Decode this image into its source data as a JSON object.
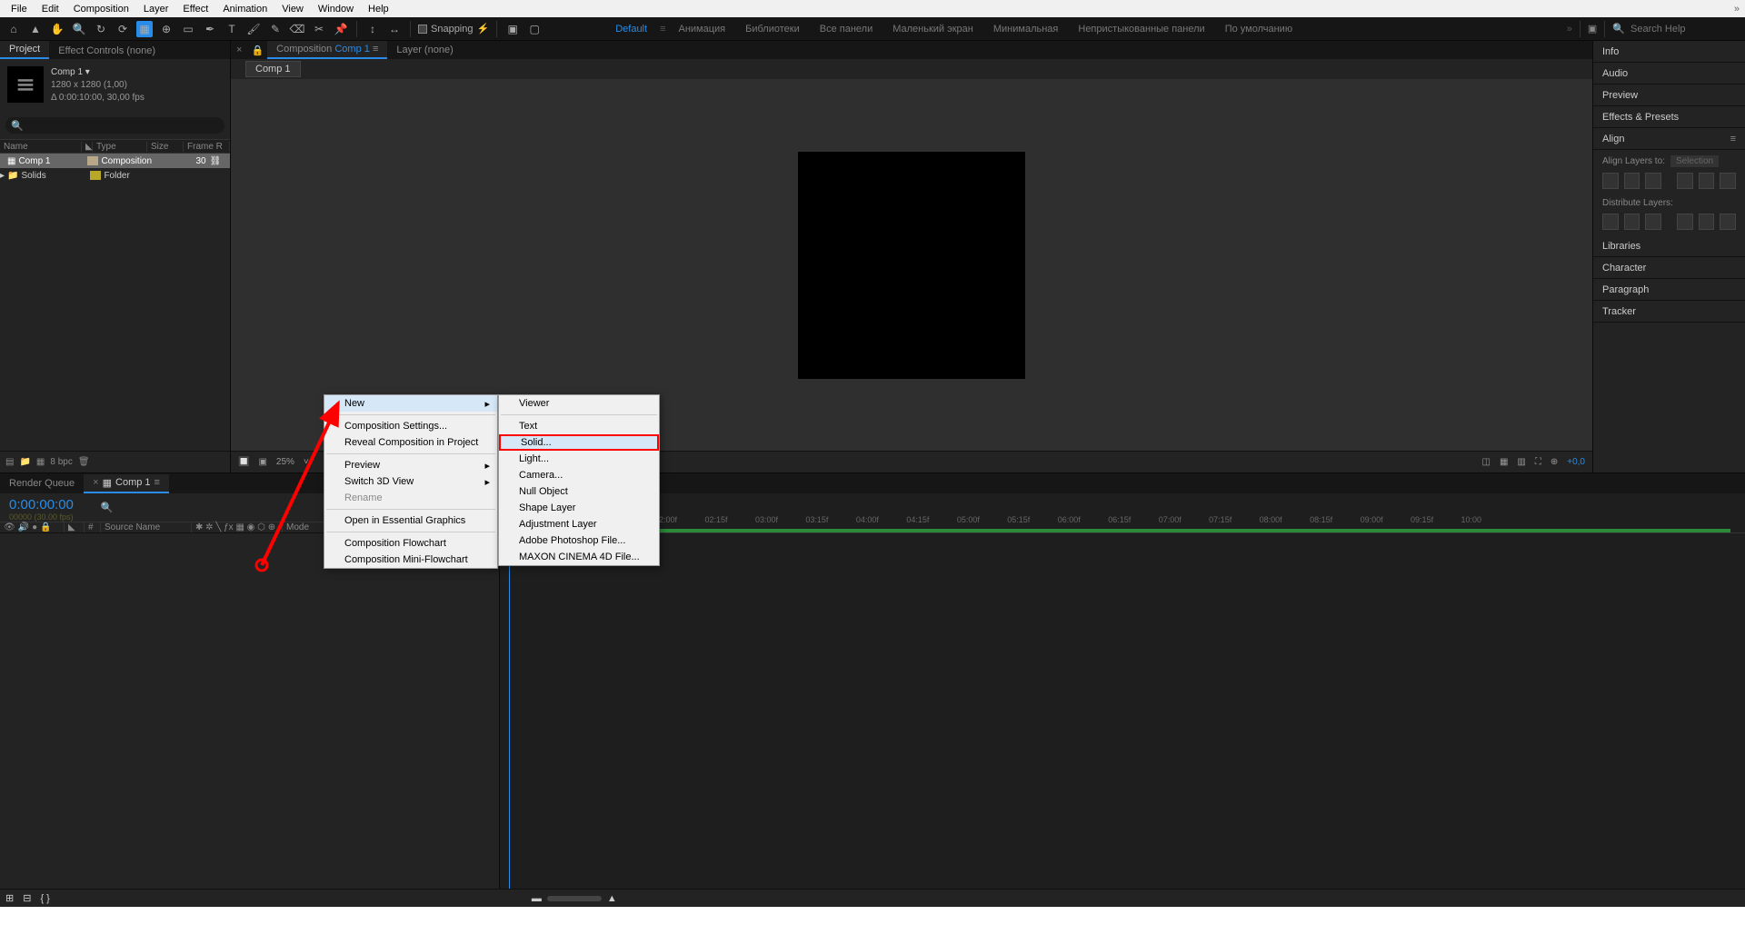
{
  "menubar": [
    "File",
    "Edit",
    "Composition",
    "Layer",
    "Effect",
    "Animation",
    "View",
    "Window",
    "Help"
  ],
  "toolbar": {
    "snapping_label": "Snapping",
    "workspaces": [
      "Default",
      "Анимация",
      "Библиотеки",
      "Все панели",
      "Маленький экран",
      "Минимальная",
      "Непристыкованные панели",
      "По умолчанию"
    ],
    "active_workspace": "Default",
    "search_placeholder": "Search Help"
  },
  "project": {
    "tab_project": "Project",
    "tab_effects": "Effect Controls (none)",
    "comp_name": "Comp 1 ▾",
    "comp_res": "1280 x 1280 (1,00)",
    "comp_dur": "Δ 0:00:10:00, 30,00 fps",
    "head_name": "Name",
    "head_type": "Type",
    "head_size": "Size",
    "head_frame": "Frame R",
    "row1_name": "Comp 1",
    "row1_type": "Composition",
    "row1_frame": "30",
    "row2_name": "Solids",
    "row2_type": "Folder",
    "foot_bpc": "8 bpc"
  },
  "viewer": {
    "tab_comp_prefix": "Composition",
    "tab_comp_link": "Comp 1",
    "tab_layer": "Layer (none)",
    "comptab": "Comp 1",
    "zoom": "25%",
    "exposure": "+0,0"
  },
  "rightpanels": {
    "p1": "Info",
    "p2": "Audio",
    "p3": "Preview",
    "p4": "Effects & Presets",
    "p5": "Align",
    "align_label": "Align Layers to:",
    "align_sel": "Selection",
    "dist_label": "Distribute Layers:",
    "p6": "Libraries",
    "p7": "Character",
    "p8": "Paragraph",
    "p9": "Tracker"
  },
  "timeline": {
    "tab_rq": "Render Queue",
    "tab_comp": "Comp 1",
    "timecode": "0:00:00:00",
    "framecount": "00000 (30.00 fps)",
    "col_source": "Source Name",
    "col_mode": "Mode",
    "ticks": [
      "02:00f",
      "02:15f",
      "03:00f",
      "03:15f",
      "04:00f",
      "04:15f",
      "05:00f",
      "05:15f",
      "06:00f",
      "06:15f",
      "07:00f",
      "07:15f",
      "08:00f",
      "08:15f",
      "09:00f",
      "09:15f",
      "10:00"
    ]
  },
  "context_menu_1": {
    "new": "New",
    "comp_settings": "Composition Settings...",
    "reveal": "Reveal Composition in Project",
    "preview": "Preview",
    "switch3d": "Switch 3D View",
    "rename": "Rename",
    "essential": "Open in Essential Graphics",
    "flowchart": "Composition Flowchart",
    "miniflow": "Composition Mini-Flowchart"
  },
  "context_menu_2": {
    "viewer": "Viewer",
    "text": "Text",
    "solid": "Solid...",
    "light": "Light...",
    "camera": "Camera...",
    "null": "Null Object",
    "shape": "Shape Layer",
    "adjust": "Adjustment Layer",
    "psd": "Adobe Photoshop File...",
    "c4d": "MAXON CINEMA 4D File..."
  }
}
